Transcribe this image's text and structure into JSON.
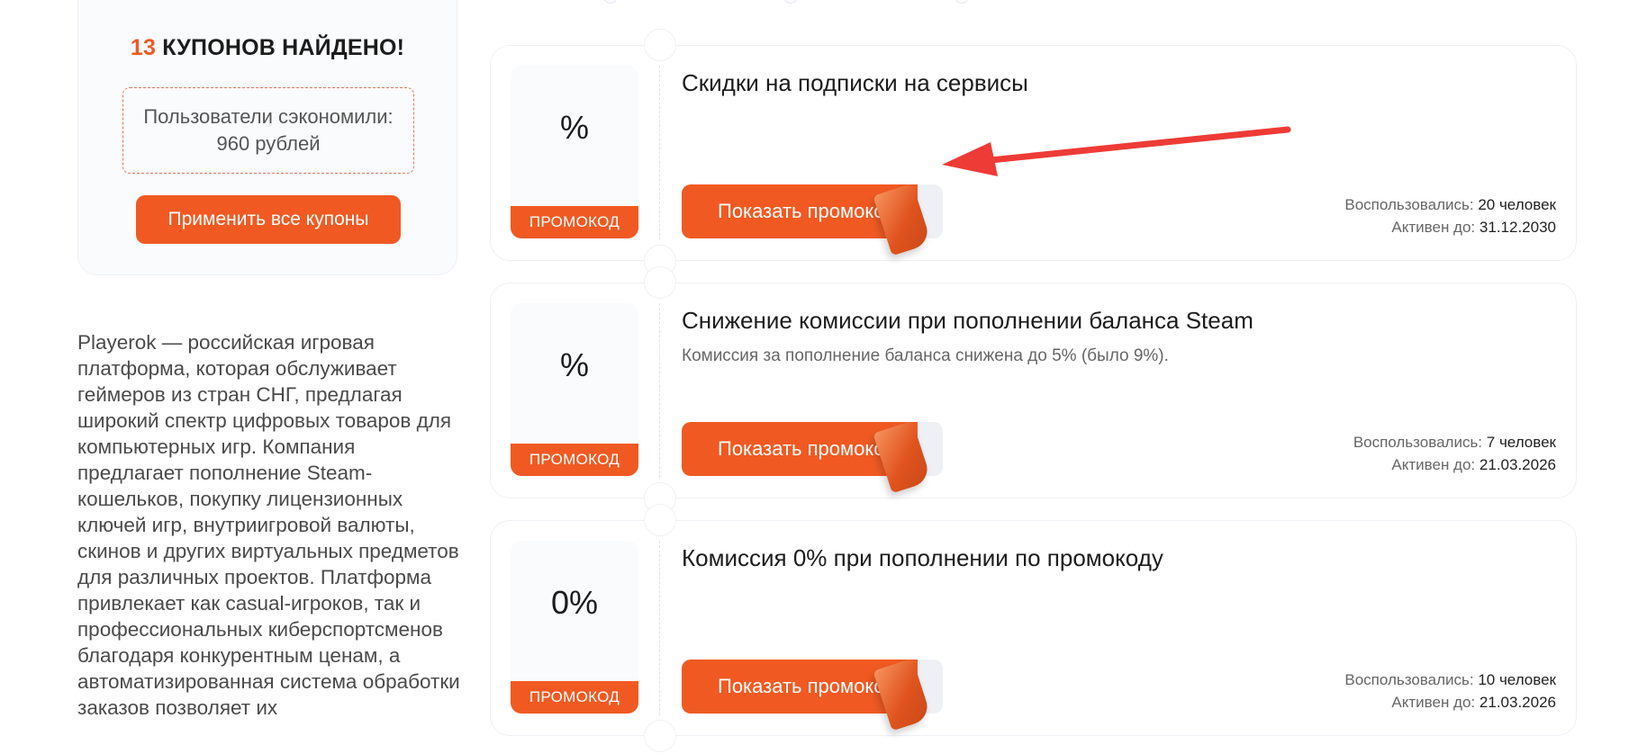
{
  "summary": {
    "found_count": "13",
    "found_text": "КУПОНОВ НАЙДЕНО!",
    "saved_text": "Пользователи сэкономили: 960 рублей",
    "apply_all_label": "Применить все купоны"
  },
  "description": "Playerok — российская игровая платформа, которая обслуживает геймеров из стран СНГ, предлагая широкий спектр цифровых товаров для компьютерных игр. Компания предлагает пополнение Steam-кошельков, покупку лицензионных ключей игр, внутриигровой валюты, скинов и других виртуальных предметов для различных проектов. Платформа привлекает как casual-игроков, так и профессиональных киберспортсменов благодаря конкурентным ценам, а автоматизированная система обработки заказов позволяет их",
  "coupons": [
    {
      "value": "%",
      "type_label": "ПРОМОКОД",
      "title": "Скидки на подписки на сервисы",
      "desc": "",
      "button_label": "Показать промокод",
      "used_label": "Воспользовались:",
      "used_value": "20 человек",
      "active_label": "Активен до:",
      "active_value": "31.12.2030"
    },
    {
      "value": "%",
      "type_label": "ПРОМОКОД",
      "title": "Снижение комиссии при пополнении баланса Steam",
      "desc": "Комиссия за пополнение баланса снижена до 5% (было 9%).",
      "button_label": "Показать промокод",
      "used_label": "Воспользовались:",
      "used_value": "7 человек",
      "active_label": "Активен до:",
      "active_value": "21.03.2026"
    },
    {
      "value": "0%",
      "type_label": "ПРОМОКОД",
      "title": "Комиссия 0% при пополнении по промокоду",
      "desc": "",
      "button_label": "Показать промокод",
      "used_label": "Воспользовались:",
      "used_value": "10 человек",
      "active_label": "Активен до:",
      "active_value": "21.03.2026"
    }
  ],
  "colors": {
    "accent": "#f05a22",
    "arrow": "#ee3b36"
  }
}
